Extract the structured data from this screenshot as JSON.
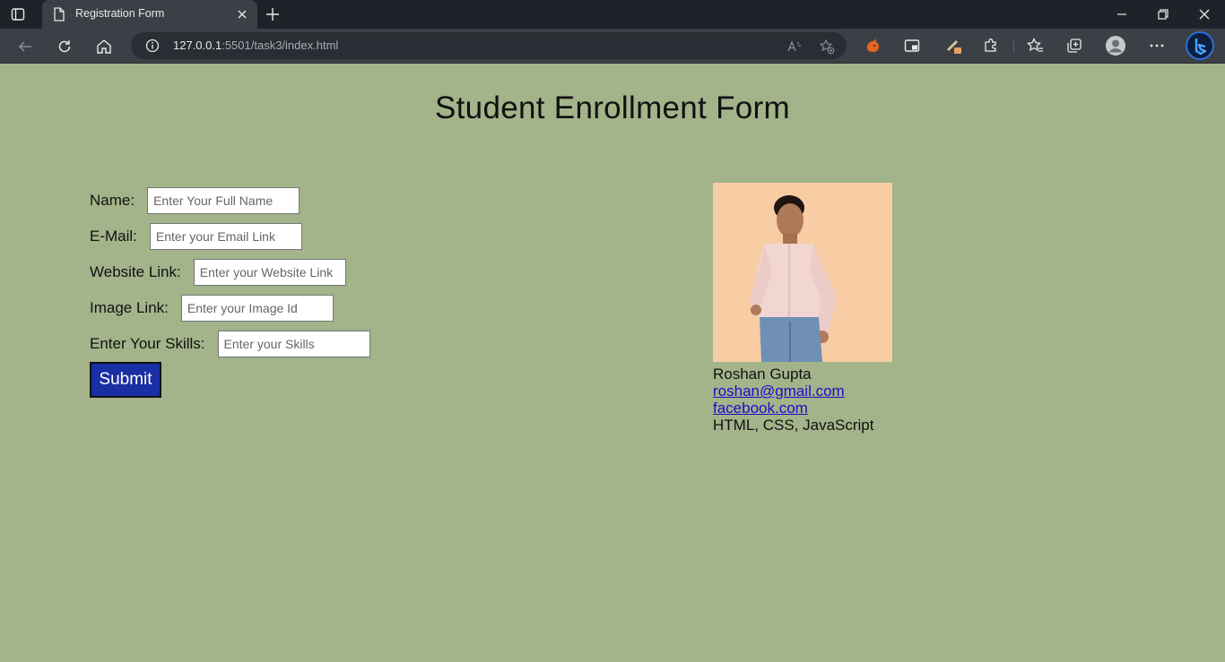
{
  "browser": {
    "tab_title": "Registration Form",
    "url_host": "127.0.0.1",
    "url_rest": ":5501/task3/index.html"
  },
  "page": {
    "heading": "Student Enrollment Form"
  },
  "form": {
    "name": {
      "label": "Name:",
      "placeholder": "Enter Your Full Name",
      "value": ""
    },
    "email": {
      "label": "E-Mail:",
      "placeholder": "Enter your Email Link",
      "value": ""
    },
    "website": {
      "label": "Website Link:",
      "placeholder": "Enter your Website Link",
      "value": ""
    },
    "image": {
      "label": "Image Link:",
      "placeholder": "Enter your Image Id",
      "value": ""
    },
    "skills": {
      "label": "Enter Your Skills:",
      "placeholder": "Enter your Skills",
      "value": ""
    },
    "submit_label": "Submit"
  },
  "student_card": {
    "name": "Roshan Gupta",
    "email": "roshan@gmail.com",
    "website": "facebook.com",
    "skills": "HTML, CSS, JavaScript"
  },
  "colors": {
    "page_background": "#a3b38a",
    "submit_background": "#1a2fa3",
    "link": "#1a0dcc"
  },
  "icons": {
    "tab_actions": "tab-actions-icon",
    "tab_page": "page-icon",
    "tab_close": "close-icon",
    "new_tab": "plus-icon",
    "back": "back-arrow-icon",
    "refresh": "refresh-icon",
    "home": "home-icon",
    "site_info": "info-icon",
    "read_aloud": "read-aloud-icon",
    "add_favorite": "star-add-icon",
    "extension_1": "extension-fox-icon",
    "extension_2": "picture-in-picture-icon",
    "extension_3": "color-picker-icon",
    "extensions": "puzzle-icon",
    "favorites": "favorites-icon",
    "collections": "collections-icon",
    "profile": "profile-avatar-icon",
    "more": "more-icon",
    "copilot": "bing-copilot-icon"
  }
}
